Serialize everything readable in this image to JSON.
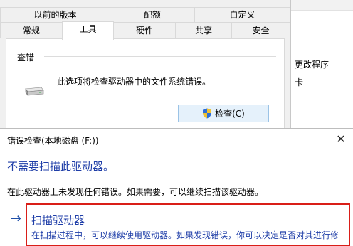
{
  "properties_dialog": {
    "tabs_row1": [
      "以前的版本",
      "配额",
      "自定义"
    ],
    "tabs_row2": [
      "常规",
      "工具",
      "硬件",
      "共享",
      "安全"
    ],
    "active_tab": "工具",
    "group_title": "查错",
    "description": "此选项将检查驱动器中的文件系统错误。",
    "check_button": "检查(C)"
  },
  "background_window": {
    "text_1": "更改程序",
    "text_2": "卡"
  },
  "error_dialog": {
    "title": "错误检查(本地磁盘 (F:))",
    "close_label": "✕",
    "headline": "不需要扫描此驱动器。",
    "body": "在此驱动器上未发现任何错误。如果需要，可以继续扫描该驱动器。",
    "command_title": "扫描驱动器",
    "command_sub": "在扫描过程中，可以继续使用驱动器。如果发现错误，你可以决定是否对其进行修",
    "arrow_icon": "arrow-right-icon"
  },
  "colors": {
    "link_blue": "#1f3ea8",
    "highlight_red": "#d91e18",
    "button_blue": "#e5f1fb"
  }
}
